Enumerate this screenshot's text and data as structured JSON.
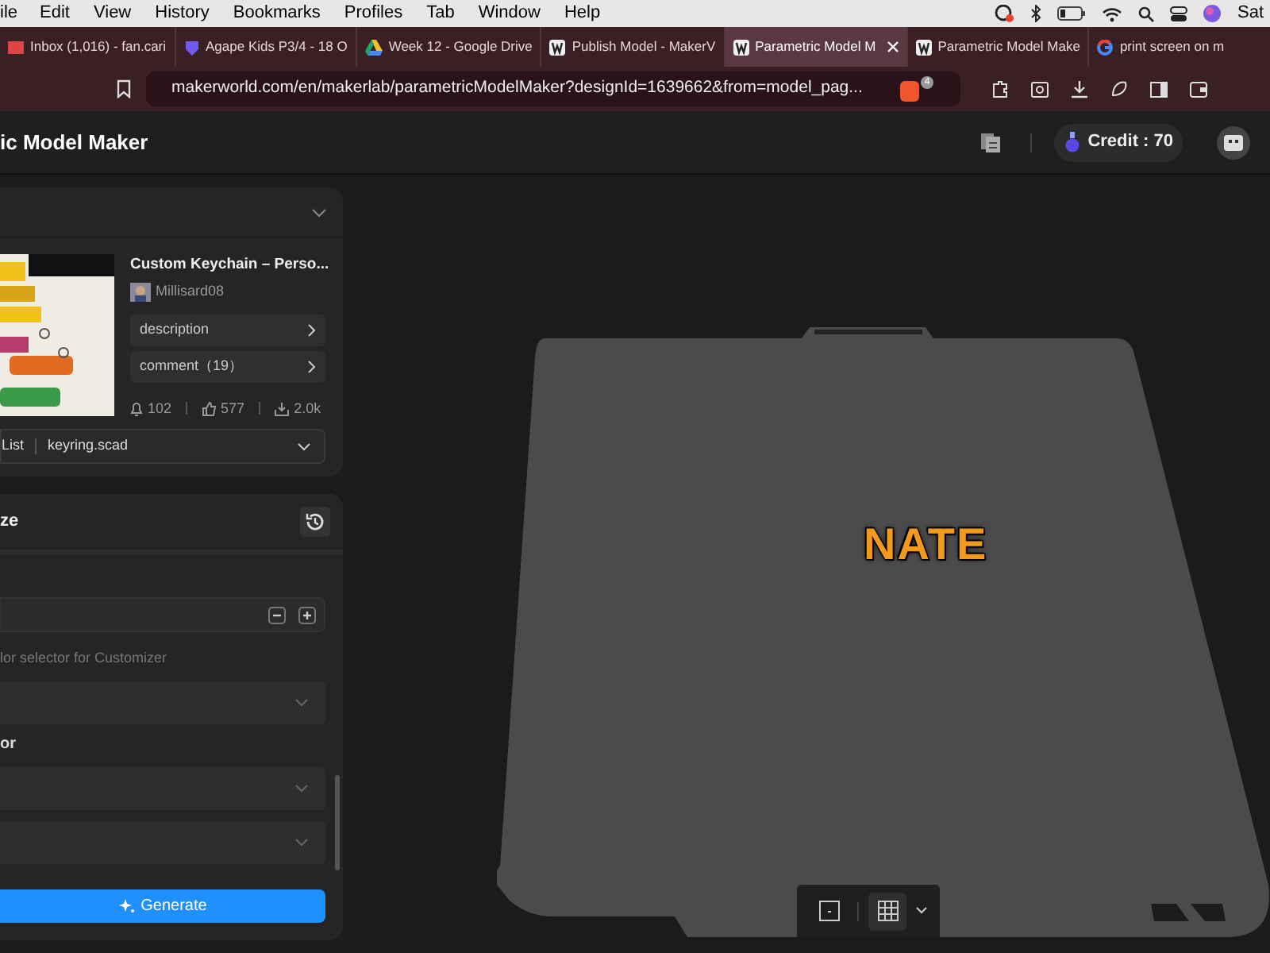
{
  "menu_bar": {
    "items": [
      "ile",
      "Edit",
      "View",
      "History",
      "Bookmarks",
      "Profiles",
      "Tab",
      "Window",
      "Help"
    ],
    "clock": "Sat"
  },
  "browser_tabs": [
    {
      "kind": "mail",
      "title": "Inbox (1,016) - fan.cari",
      "selected": false
    },
    {
      "kind": "shield",
      "title": "Agape Kids P3/4 - 18 O",
      "selected": false
    },
    {
      "kind": "drive",
      "title": "Week 12 - Google Drive",
      "selected": false
    },
    {
      "kind": "maker",
      "title": "Publish Model - MakerV",
      "selected": false
    },
    {
      "kind": "maker",
      "title": "Parametric Model M",
      "selected": true
    },
    {
      "kind": "maker",
      "title": "Parametric Model Make",
      "selected": false
    },
    {
      "kind": "google",
      "title": "print screen on m",
      "selected": false
    }
  ],
  "address_bar": {
    "url": "makerworld.com/en/makerlab/parametricModelMaker?designId=1639662&from=model_pag...",
    "extension_badge": "4"
  },
  "app_header": {
    "title": "ic Model Maker",
    "credit": "Credit : 70"
  },
  "model_card": {
    "title": "Custom Keychain – Perso...",
    "author": "Millisard08",
    "links": [
      "description",
      "comment（19）"
    ],
    "stats": [
      {
        "kind": "boost",
        "value": "102"
      },
      {
        "kind": "like",
        "value": "577"
      },
      {
        "kind": "download",
        "value": "2.0k"
      }
    ],
    "file_label": "List",
    "file": "keyring.scad"
  },
  "customize": {
    "title": "ze",
    "params": [
      {
        "kind": "stub"
      },
      {
        "kind": "number"
      },
      {
        "kind": "note",
        "text": "lor selector for Customizer"
      },
      {
        "kind": "select"
      },
      {
        "kind": "label",
        "text": "or"
      },
      {
        "kind": "select"
      },
      {
        "kind": "select"
      }
    ],
    "generate": "Generate"
  },
  "viewport": {
    "model_text": "NATE",
    "view_modes": [
      {
        "kind": "single",
        "selected": false
      },
      {
        "kind": "grid",
        "selected": true
      }
    ]
  }
}
